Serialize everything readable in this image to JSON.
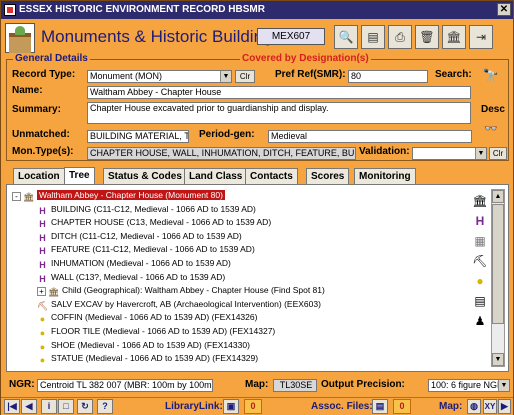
{
  "window": {
    "title": "ESSEX HISTORIC ENVIRONMENT RECORD HBSMR",
    "close_label": "✕"
  },
  "header": {
    "title": "Monuments & Historic Buildings",
    "record_code": "MEX607"
  },
  "toolbar": [
    {
      "name": "print-preview-icon",
      "glyph": "🔍"
    },
    {
      "name": "report-icon",
      "glyph": "▤"
    },
    {
      "name": "print-icon",
      "glyph": "⎙"
    },
    {
      "name": "delete-icon",
      "glyph": "🗑"
    },
    {
      "name": "monument-icon",
      "glyph": "🏛"
    },
    {
      "name": "exit-icon",
      "glyph": "⇥"
    }
  ],
  "general": {
    "legend": "General Details",
    "designation": "Covered by Designation(s)",
    "record_type_label": "Record Type:",
    "record_type_value": "Monument (MON)",
    "clr_label": "Clr",
    "pref_ref_label": "Pref Ref(SMR):",
    "pref_ref_value": "80",
    "search_label": "Search:",
    "name_label": "Name:",
    "name_value": "Waltham Abbey - Chapter House",
    "summary_label": "Summary:",
    "summary_value": "Chapter House excavated prior to guardianship and display.",
    "desc_label": "Desc",
    "unmatched_label": "Unmatched:",
    "unmatched_value": "BUILDING MATERIAL, T",
    "period_gen_label": "Period-gen:",
    "period_gen_value": "Medieval",
    "montype_label": "Mon.Type(s):",
    "montype_value": "CHAPTER HOUSE, WALL, INHUMATION, DITCH, FEATURE, BUILDI",
    "validation_label": "Validation:",
    "validation_value": "",
    "clr2_label": "Clr"
  },
  "tabs": [
    "Location",
    "Tree",
    "Status & Codes",
    "Land Class",
    "Contacts",
    "Scores",
    "Monitoring"
  ],
  "active_tab": "Tree",
  "tree": [
    {
      "text": "Waltham Abbey - Chapter House (Monument 80)",
      "icon": "monument-icon",
      "glyph": "🏛",
      "indent": 0,
      "expander": "-",
      "selected": true
    },
    {
      "text": "BUILDING (C11-C12, Medieval - 1066 AD to 1539 AD)",
      "icon": "montype-icon",
      "glyph": "H",
      "indent": 1
    },
    {
      "text": "CHAPTER HOUSE (C13, Medieval - 1066 AD to 1539 AD)",
      "icon": "montype-icon",
      "glyph": "H",
      "indent": 1
    },
    {
      "text": "DITCH (C11-C12, Medieval - 1066 AD to 1539 AD)",
      "icon": "montype-icon",
      "glyph": "H",
      "indent": 1
    },
    {
      "text": "FEATURE (C11-C12, Medieval - 1066 AD to 1539 AD)",
      "icon": "montype-icon",
      "glyph": "H",
      "indent": 1
    },
    {
      "text": "INHUMATION (Medieval - 1066 AD to 1539 AD)",
      "icon": "montype-icon",
      "glyph": "H",
      "indent": 1
    },
    {
      "text": "WALL (C13?, Medieval - 1066 AD to 1539 AD)",
      "icon": "montype-icon",
      "glyph": "H",
      "indent": 1
    },
    {
      "text": "Child (Geographical): Waltham Abbey - Chapter House (Find Spot 81)",
      "icon": "monument-icon",
      "glyph": "🏛",
      "indent": 1,
      "expander": "+"
    },
    {
      "text": "SALV EXCAV by Havercroft, AB (Archaeological Intervention) (EEX603)",
      "icon": "event-icon",
      "glyph": "⛏",
      "indent": 1
    },
    {
      "text": "COFFIN (Medieval - 1066 AD to 1539 AD) (FEX14326)",
      "icon": "find-icon",
      "glyph": "●",
      "indent": 1
    },
    {
      "text": "FLOOR TILE (Medieval - 1066 AD to 1539 AD) (FEX14327)",
      "icon": "find-icon",
      "glyph": "●",
      "indent": 1
    },
    {
      "text": "SHOE (Medieval - 1066 AD to 1539 AD) (FEX14330)",
      "icon": "find-icon",
      "glyph": "●",
      "indent": 1
    },
    {
      "text": "STATUE (Medieval - 1066 AD to 1539 AD) (FEX14329)",
      "icon": "find-icon",
      "glyph": "●",
      "indent": 1
    }
  ],
  "bottom": {
    "ngr_label": "NGR:",
    "ngr_value": "Centroid TL 382 007  (MBR: 100m by 100m)",
    "map_label": "Map:",
    "map_value": "TL30SE",
    "precision_label": "Output Precision:",
    "precision_value": "100:  6 figure NGR"
  },
  "nav": {
    "library_label": "LibraryLink:",
    "library_count": "0",
    "assoc_label": "Assoc. Files:",
    "assoc_count": "0",
    "map_label": "Map:",
    "xy_label": "XY"
  },
  "colors": {
    "panel": "#f5a43f",
    "title_bar": "#2e2a6e",
    "heading": "#1c1c7a",
    "designation": "#d61f1f",
    "selection": "#c01515"
  }
}
